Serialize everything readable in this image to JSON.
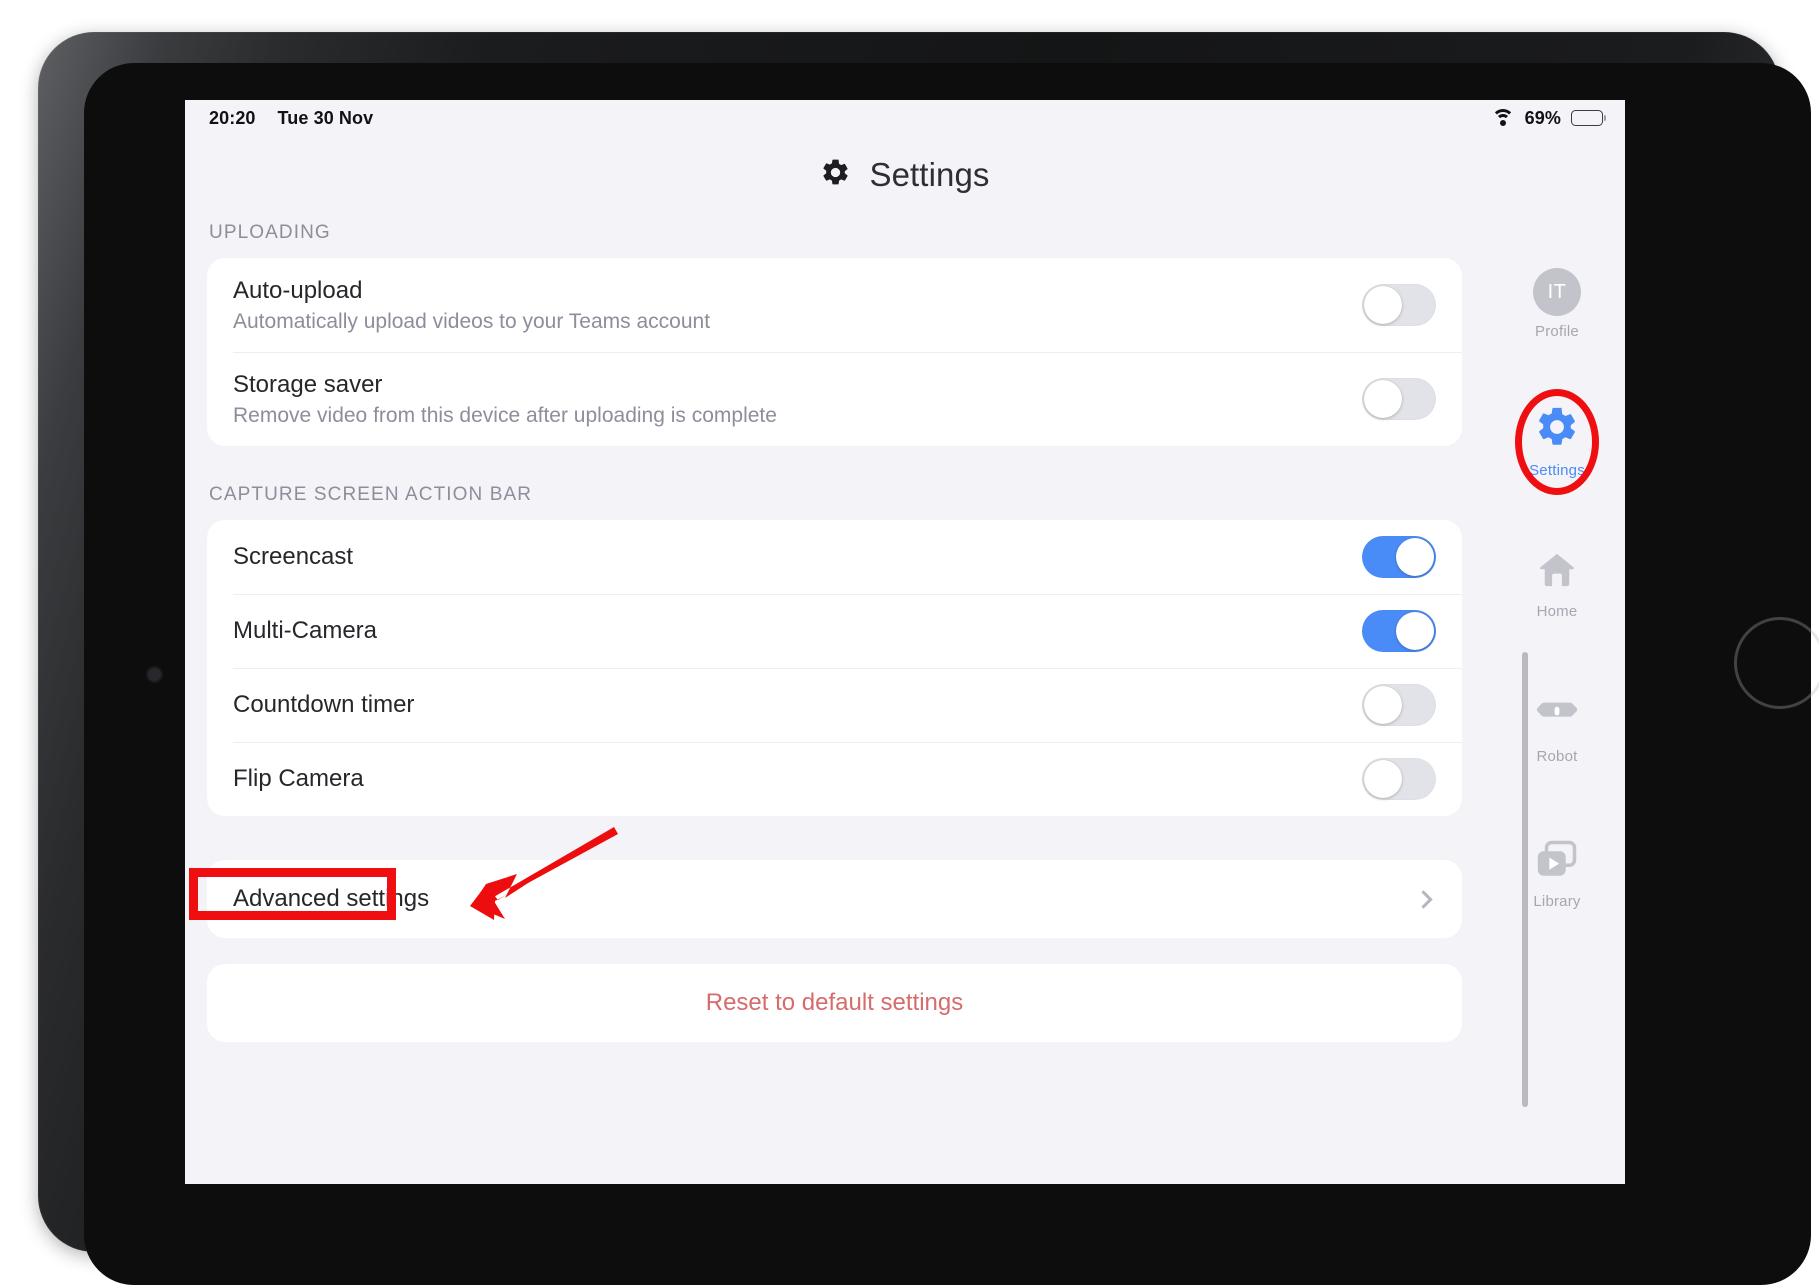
{
  "device": {
    "type": "tablet",
    "orientation": "landscape",
    "home_button": "home-button",
    "front_camera": "front-camera"
  },
  "status_bar": {
    "time": "20:20",
    "date": "Tue 30 Nov",
    "wifi_icon": "wifi-icon",
    "battery_percent": "69%",
    "battery_level": 69,
    "battery_icon": "battery-icon"
  },
  "header": {
    "icon": "gear-icon",
    "title": "Settings"
  },
  "sections": [
    {
      "label": "UPLOADING",
      "rows": [
        {
          "title": "Auto-upload",
          "subtitle": "Automatically upload videos to your Teams account",
          "control": "toggle",
          "state": "off"
        },
        {
          "title": "Storage saver",
          "subtitle": "Remove video from this device after uploading is complete",
          "control": "toggle",
          "state": "off"
        }
      ]
    },
    {
      "label": "CAPTURE SCREEN ACTION BAR",
      "rows": [
        {
          "title": "Screencast",
          "subtitle": "",
          "control": "toggle",
          "state": "on"
        },
        {
          "title": "Multi-Camera",
          "subtitle": "",
          "control": "toggle",
          "state": "on"
        },
        {
          "title": "Countdown timer",
          "subtitle": "",
          "control": "toggle",
          "state": "off"
        },
        {
          "title": "Flip Camera",
          "subtitle": "",
          "control": "toggle",
          "state": "off"
        }
      ]
    }
  ],
  "advanced_row": {
    "title": "Advanced settings",
    "control": "chevron-right-icon"
  },
  "reset": {
    "label": "Reset to default settings"
  },
  "right_rail": {
    "items": [
      {
        "label": "Profile",
        "icon": "avatar-icon",
        "avatar_initials": "IT",
        "active": false
      },
      {
        "label": "Settings",
        "icon": "gear-icon",
        "active": true
      },
      {
        "label": "Home",
        "icon": "home-icon",
        "active": false
      },
      {
        "label": "Robot",
        "icon": "robot-icon",
        "active": false
      },
      {
        "label": "Library",
        "icon": "library-icon",
        "active": false
      }
    ]
  },
  "annotations": {
    "highlight_box_target": "Advanced settings",
    "arrow_target": "Advanced settings",
    "circle_target": "Settings",
    "color": "#ef0f10"
  },
  "colors": {
    "screen_background": "#f3f3f8",
    "card_background": "#ffffff",
    "toggle_on": "#4a8cf7",
    "toggle_off": "#e2e3e8",
    "accent_blue": "#4a8cf7",
    "reset_red": "#d66b6b",
    "annotation_red": "#ef0f10",
    "section_label": "#8d8e9a"
  }
}
